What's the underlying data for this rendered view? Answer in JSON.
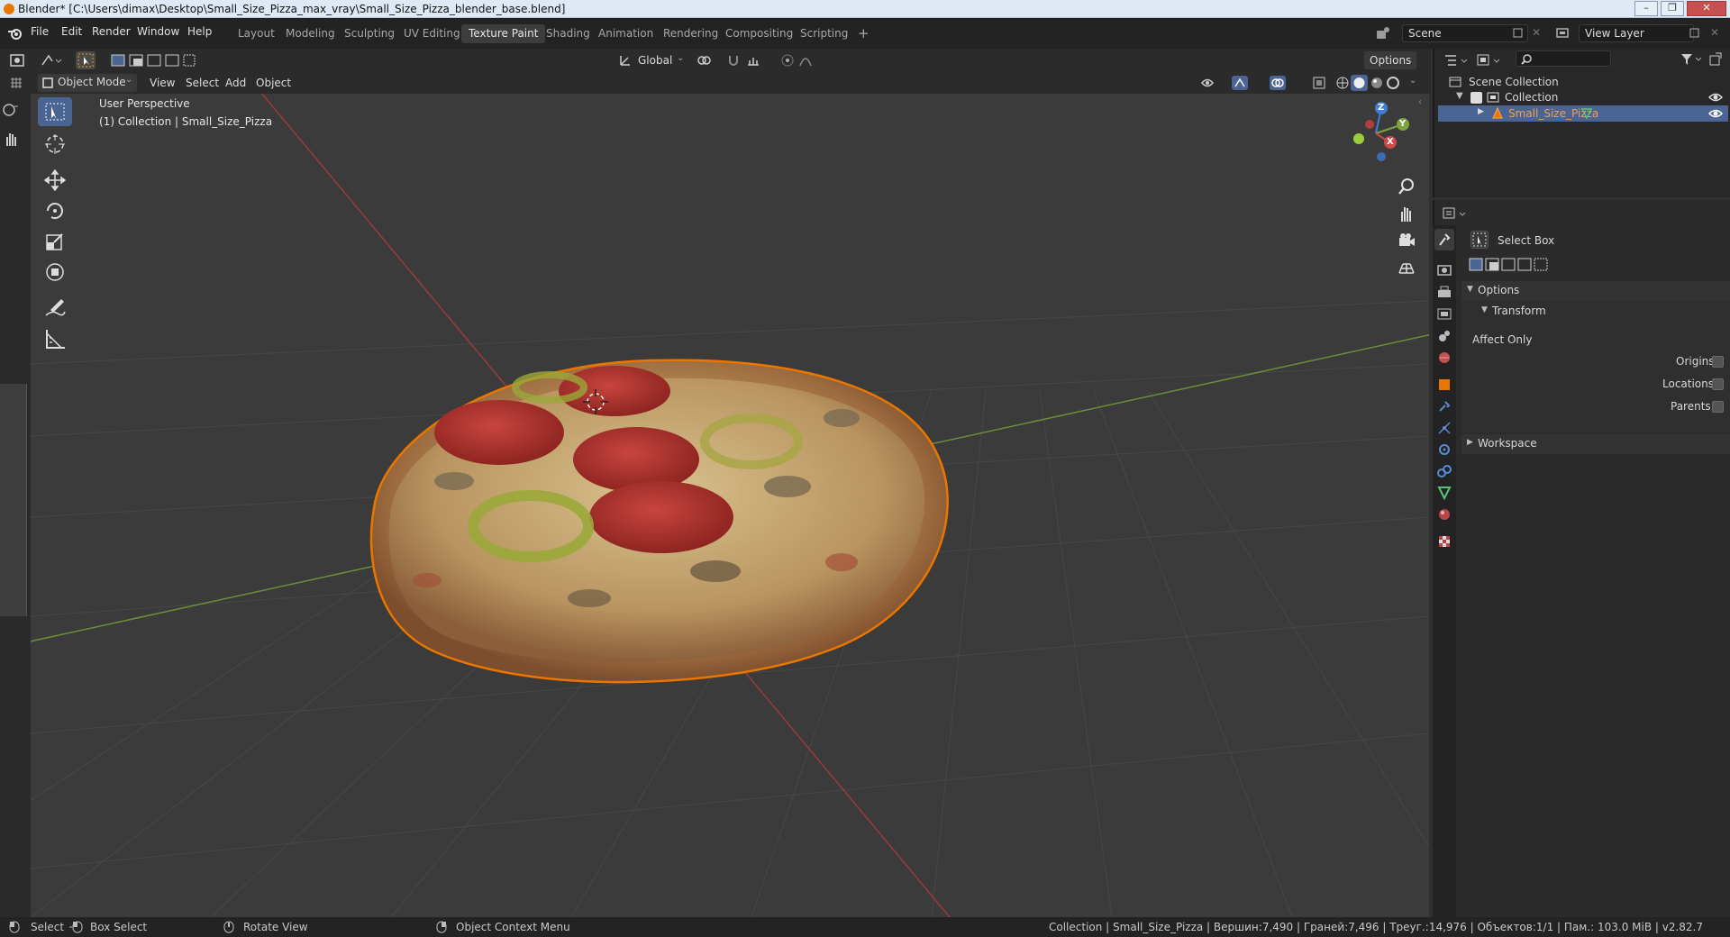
{
  "window": {
    "title": "Blender* [C:\\Users\\dimax\\Desktop\\Small_Size_Pizza_max_vray\\Small_Size_Pizza_blender_base.blend]"
  },
  "menu": [
    "File",
    "Edit",
    "Render",
    "Window",
    "Help"
  ],
  "workspaces": [
    "Layout",
    "Modeling",
    "Sculpting",
    "UV Editing",
    "Texture Paint",
    "Shading",
    "Animation",
    "Rendering",
    "Compositing",
    "Scripting"
  ],
  "active_workspace": "Texture Paint",
  "scene": {
    "name": "Scene",
    "view_layer": "View Layer"
  },
  "viewport_header": {
    "mode": "Object Mode",
    "menus": [
      "View",
      "Select",
      "Add",
      "Object"
    ],
    "transform_orientation": "Global",
    "options_label": "Options"
  },
  "viewport": {
    "perspective_label": "User Perspective",
    "context_label": "(1) Collection | Small_Size_Pizza",
    "gizmo": {
      "z": "Z",
      "y": "Y",
      "x": "X"
    }
  },
  "outliner": {
    "root": "Scene Collection",
    "collection": "Collection",
    "object": "Small_Size_Pizza"
  },
  "properties": {
    "tool_name": "Select Box",
    "options_panel": "Options",
    "transform_panel": "Transform",
    "affect_only": "Affect Only",
    "origins": "Origins",
    "locations": "Locations",
    "parents": "Parents",
    "workspace_panel": "Workspace"
  },
  "statusbar": {
    "select": "Select",
    "box_select": "Box Select",
    "rotate_view": "Rotate View",
    "context_menu": "Object Context Menu",
    "stats": "Collection | Small_Size_Pizza | Вершин:7,490 | Граней:7,496 | Треуг.:14,976 | Объектов:1/1 | Пам.: 103.0 MiB | v2.82.7"
  },
  "colors": {
    "accent": "#4a6494",
    "selected_object": "#ea7600",
    "axis_x": "#c44a4a",
    "axis_y": "#7aa43c",
    "axis_z": "#3e7ed6"
  }
}
